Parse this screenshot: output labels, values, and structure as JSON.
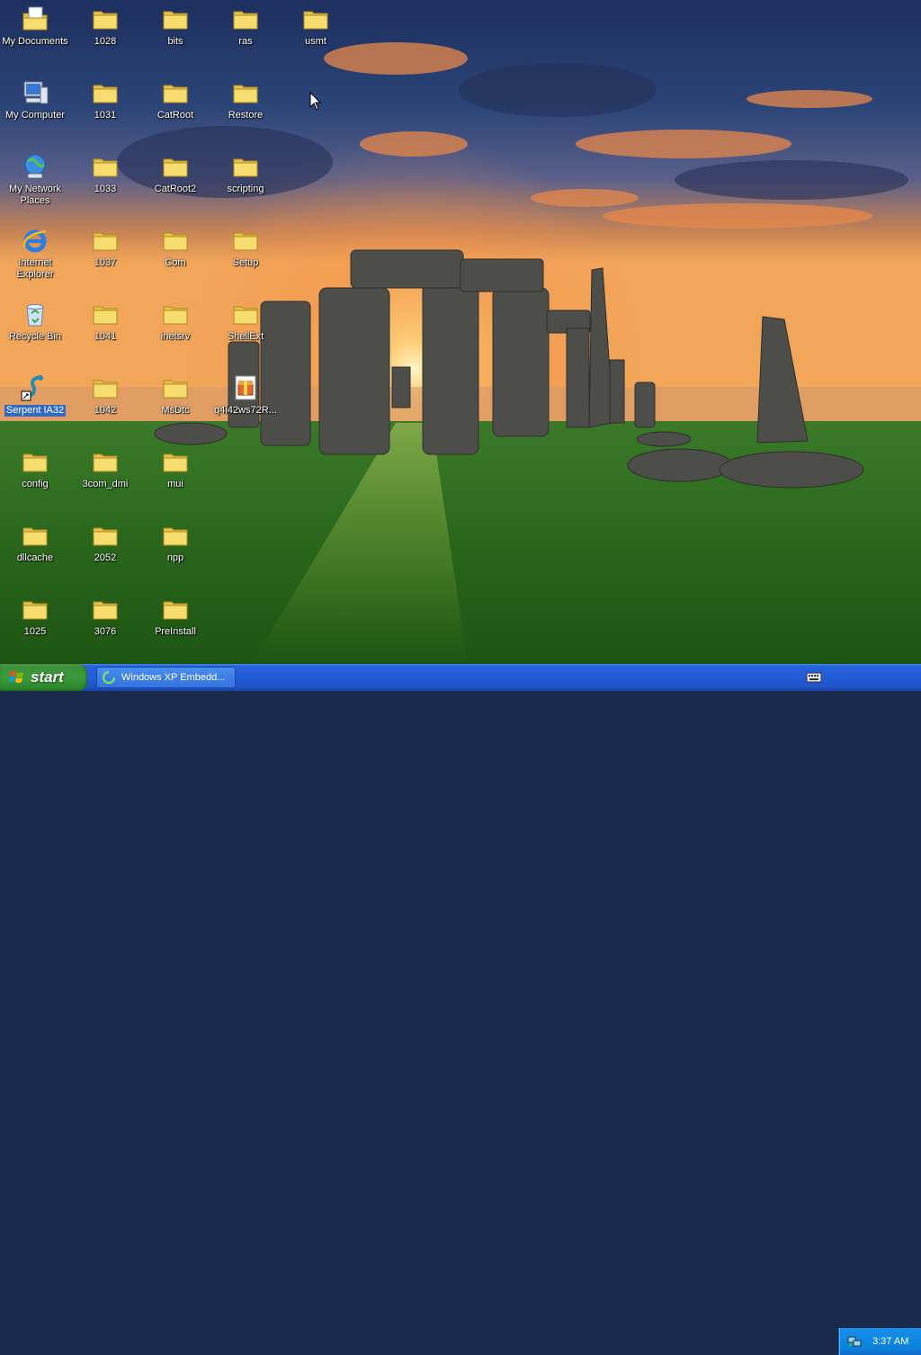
{
  "desktop": {
    "icons": [
      {
        "label": "My Documents"
      },
      {
        "label": "My Computer"
      },
      {
        "label": "My Network Places"
      },
      {
        "label": "Internet Explorer"
      },
      {
        "label": "Recycle Bin"
      },
      {
        "label": "Serpent IA32"
      },
      {
        "label": "config"
      },
      {
        "label": "dllcache"
      },
      {
        "label": "1025"
      },
      {
        "label": "1028"
      },
      {
        "label": "1031"
      },
      {
        "label": "1033"
      },
      {
        "label": "1037"
      },
      {
        "label": "1041"
      },
      {
        "label": "1042"
      },
      {
        "label": "3com_dmi"
      },
      {
        "label": "2052"
      },
      {
        "label": "3076"
      },
      {
        "label": "bits"
      },
      {
        "label": "CatRoot"
      },
      {
        "label": "CatRoot2"
      },
      {
        "label": "Com"
      },
      {
        "label": "inetsrv"
      },
      {
        "label": "MsDtc"
      },
      {
        "label": "mui"
      },
      {
        "label": "npp"
      },
      {
        "label": "PreInstall"
      },
      {
        "label": "ras"
      },
      {
        "label": "Restore"
      },
      {
        "label": "scripting"
      },
      {
        "label": "Setup"
      },
      {
        "label": "ShellExt"
      },
      {
        "label": "q4i42ws72R..."
      },
      {
        "label": "usmt"
      }
    ]
  },
  "taskbar": {
    "start_label": "start",
    "task_item_label": "Windows XP Embedd...",
    "clock": "3:37 AM"
  }
}
